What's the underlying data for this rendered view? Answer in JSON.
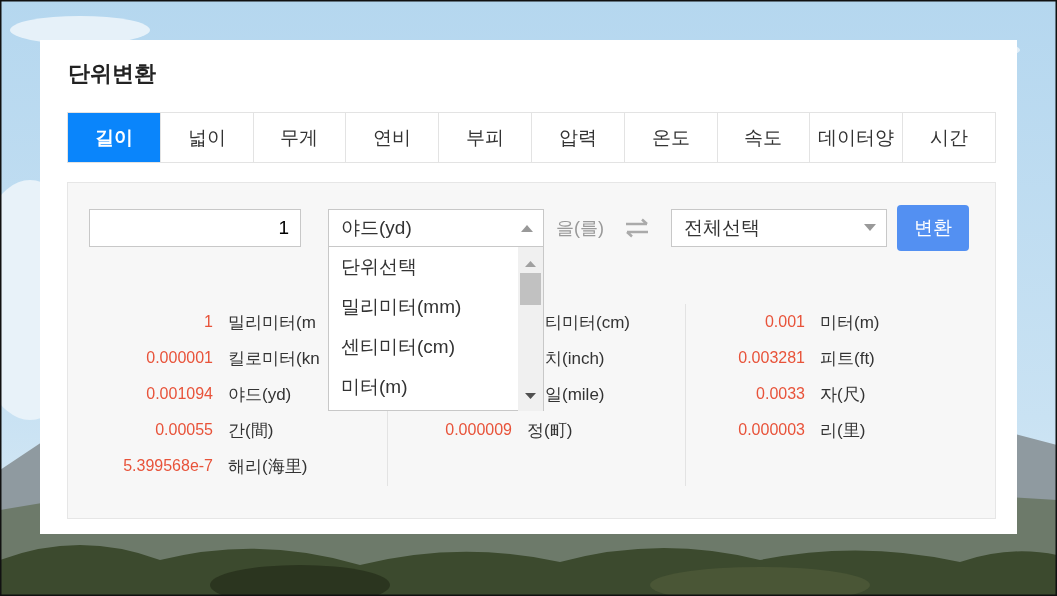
{
  "title": "단위변환",
  "tabs": [
    {
      "label": "길이",
      "selected": true
    },
    {
      "label": "넓이",
      "selected": false
    },
    {
      "label": "무게",
      "selected": false
    },
    {
      "label": "연비",
      "selected": false
    },
    {
      "label": "부피",
      "selected": false
    },
    {
      "label": "압력",
      "selected": false
    },
    {
      "label": "온도",
      "selected": false
    },
    {
      "label": "속도",
      "selected": false
    },
    {
      "label": "데이터양",
      "selected": false
    },
    {
      "label": "시간",
      "selected": false
    }
  ],
  "converter": {
    "amount": "1",
    "from_unit": "야드(yd)",
    "expanded": true,
    "options": [
      {
        "label": "단위선택",
        "selected": false
      },
      {
        "label": "밀리미터(mm)",
        "selected": false
      },
      {
        "label": "센티미터(cm)",
        "selected": false
      },
      {
        "label": "미터(m)",
        "selected": false
      }
    ],
    "connector": "을(를)",
    "to_unit": "전체선택",
    "convert_button": "변환"
  },
  "results": [
    [
      {
        "value": "1",
        "unit": "밀리미터(m"
      },
      {
        "value": "0.000001",
        "unit": "킬로미터(kn"
      },
      {
        "value": "0.001094",
        "unit": "야드(yd)"
      },
      {
        "value": "0.00055",
        "unit": "간(間)"
      },
      {
        "value": "5.399568e-7",
        "unit": "해리(海里)"
      }
    ],
    [
      {
        "unit": "티미터(cm)"
      },
      {
        "unit": "치(inch)"
      },
      {
        "unit": "일(mile)"
      },
      {
        "value": "0.000009",
        "unit": "정(町)"
      }
    ],
    [
      {
        "value": "0.001",
        "unit": "미터(m)"
      },
      {
        "value": "0.003281",
        "unit": "피트(ft)"
      },
      {
        "value": "0.0033",
        "unit": "자(尺)"
      },
      {
        "value": "0.000003",
        "unit": "리(里)"
      }
    ]
  ]
}
